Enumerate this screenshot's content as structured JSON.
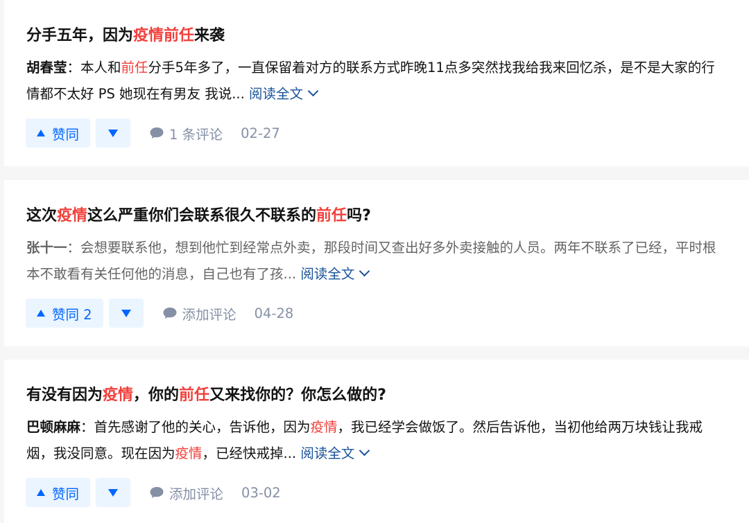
{
  "colors": {
    "highlight": "#f1403c",
    "link": "#175199",
    "vote_bg": "#ebf5ff",
    "vote_fg": "#0066ff",
    "meta": "#8590a6"
  },
  "cards": [
    {
      "title": [
        {
          "text": "分手五年，因为",
          "hl": false
        },
        {
          "text": "疫情前任",
          "hl": true
        },
        {
          "text": "来袭",
          "hl": false
        }
      ],
      "author": "胡春莹",
      "excerpt": [
        {
          "text": "：本人和",
          "hl": false
        },
        {
          "text": "前任",
          "hl": true
        },
        {
          "text": "分手5年多了，一直保留着对方的联系方式昨晚11点多突然找我给我来回忆杀，是不是大家的行情都不太好 PS 她现在有男友 我说...",
          "hl": false
        }
      ],
      "read_more": "阅读全文",
      "upvote_label": "赞同",
      "comment_label": "1 条评论",
      "date": "02-27"
    },
    {
      "title": [
        {
          "text": "这次",
          "hl": false
        },
        {
          "text": "疫情",
          "hl": true
        },
        {
          "text": "这么严重你们会联系很久不联系的",
          "hl": false
        },
        {
          "text": "前任",
          "hl": true
        },
        {
          "text": "吗?",
          "hl": false
        }
      ],
      "author": "张十一",
      "excerpt": [
        {
          "text": "：会想要联系他，想到他忙到经常点外卖，那段时间又查出好多外卖接触的人员。两年不联系了已经，平时根本不敢看有关任何他的消息，自己也有了孩...",
          "hl": false
        }
      ],
      "read_more": "阅读全文",
      "upvote_label": "赞同 2",
      "comment_label": "添加评论",
      "date": "04-28"
    },
    {
      "title": [
        {
          "text": "有没有因为",
          "hl": false
        },
        {
          "text": "疫情",
          "hl": true
        },
        {
          "text": "，你的",
          "hl": false
        },
        {
          "text": "前任",
          "hl": true
        },
        {
          "text": "又来找你的？你怎么做的?",
          "hl": false
        }
      ],
      "author": "巴顿麻麻",
      "excerpt": [
        {
          "text": "：首先感谢了他的关心，告诉他，因为",
          "hl": false
        },
        {
          "text": "疫情",
          "hl": true
        },
        {
          "text": "，我已经学会做饭了。然后告诉他，当初他给两万块钱让我戒烟，我没同意。现在因为",
          "hl": false
        },
        {
          "text": "疫情",
          "hl": true
        },
        {
          "text": "，已经快戒掉...",
          "hl": false
        }
      ],
      "read_more": "阅读全文",
      "upvote_label": "赞同",
      "comment_label": "添加评论",
      "date": "03-02"
    }
  ]
}
